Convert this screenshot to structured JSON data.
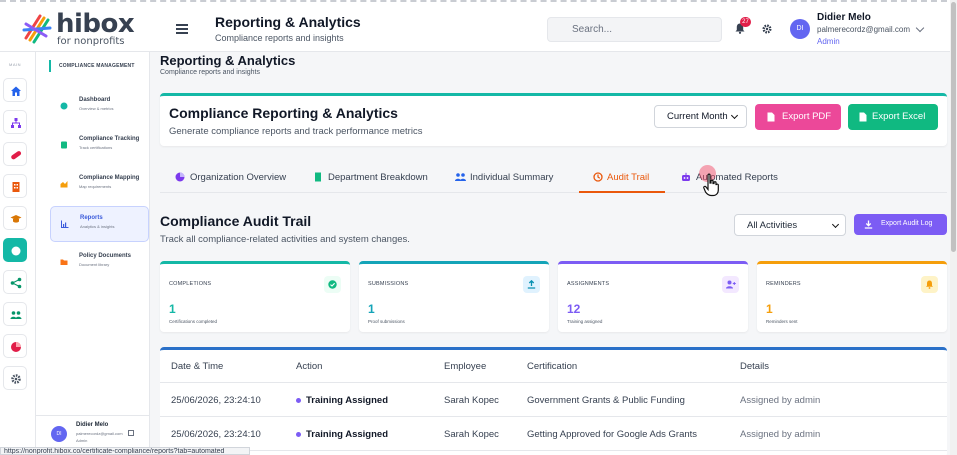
{
  "brand": {
    "name": "hibox",
    "tagline": "for nonprofits"
  },
  "header": {
    "title": "Reporting & Analytics",
    "subtitle": "Compliance reports and insights",
    "search_placeholder": "Search...",
    "notification_count": "27",
    "user": {
      "initials": "DI",
      "name": "Didier Melo",
      "email": "palmerecordz@gmail.com",
      "role": "Admin"
    }
  },
  "rail": {
    "label": "MAIN"
  },
  "sidebar": {
    "section": "COMPLIANCE MANAGEMENT",
    "items": [
      {
        "title": "Dashboard",
        "subtitle": "Overview & metrics"
      },
      {
        "title": "Compliance Tracking",
        "subtitle": "Track certifications"
      },
      {
        "title": "Compliance Mapping",
        "subtitle": "Map requirements"
      },
      {
        "title": "Reports",
        "subtitle": "Analytics & insights"
      },
      {
        "title": "Policy Documents",
        "subtitle": "Document library"
      }
    ],
    "user": {
      "initials": "DI",
      "name": "Didier Melo",
      "email": "palmerecordz@gmail.com",
      "role": "Admin"
    }
  },
  "page": {
    "title": "Reporting & Analytics",
    "subtitle": "Compliance reports and insights"
  },
  "hero": {
    "title": "Compliance Reporting & Analytics",
    "subtitle": "Generate compliance reports and track performance metrics",
    "period": "Current Month",
    "export_pdf": "Export PDF",
    "export_excel": "Export Excel"
  },
  "tabs": [
    {
      "label": "Organization Overview"
    },
    {
      "label": "Department Breakdown"
    },
    {
      "label": "Individual Summary"
    },
    {
      "label": "Audit Trail"
    },
    {
      "label": "Automated Reports"
    }
  ],
  "audit": {
    "title": "Compliance Audit Trail",
    "subtitle": "Track all compliance-related activities and system changes.",
    "filter": "All Activities",
    "export_label": "Export Audit Log"
  },
  "stats": [
    {
      "label": "COMPLETIONS",
      "value": "1",
      "desc": "Certifications completed",
      "color": "#14b8a6"
    },
    {
      "label": "SUBMISSIONS",
      "value": "1",
      "desc": "Proof submissions",
      "color": "#14a4b8"
    },
    {
      "label": "ASSIGNMENTS",
      "value": "12",
      "desc": "Training assigned",
      "color": "#7c5cf4"
    },
    {
      "label": "REMINDERS",
      "value": "1",
      "desc": "Reminders sent",
      "color": "#f59e0b"
    }
  ],
  "table": {
    "headers": [
      "Date & Time",
      "Action",
      "Employee",
      "Certification",
      "Details"
    ],
    "rows": [
      [
        "25/06/2026, 23:24:10",
        "Training Assigned",
        "Sarah Kopec",
        "Government Grants & Public Funding",
        "Assigned by admin"
      ],
      [
        "25/06/2026, 23:24:10",
        "Training Assigned",
        "Sarah Kopec",
        "Getting Approved for Google Ads Grants",
        "Assigned by admin"
      ]
    ]
  },
  "status_url": "https://nonprofit.hibox.co/certificate-compliance/reports?tab=automated"
}
